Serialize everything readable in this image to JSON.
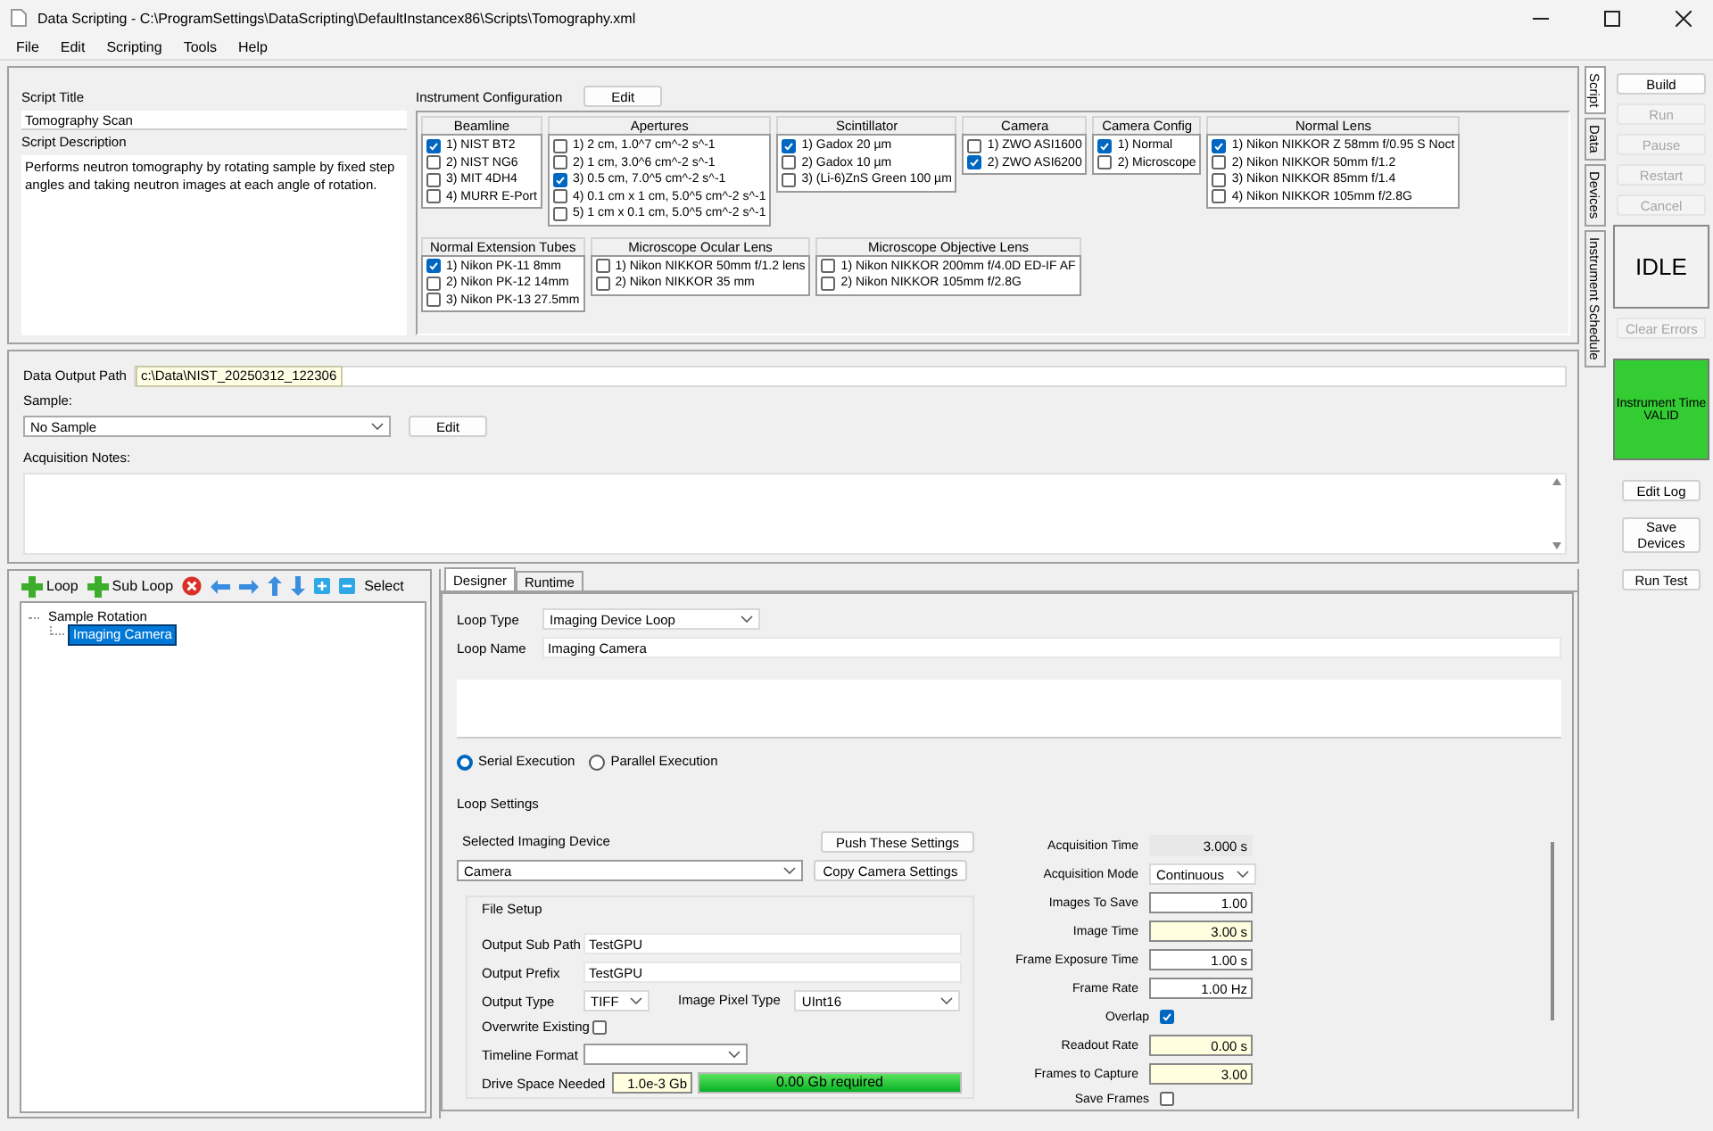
{
  "window": {
    "title": "Data Scripting - C:\\ProgramSettings\\DataScripting\\DefaultInstancex86\\Scripts\\Tomography.xml",
    "menu": [
      "File",
      "Edit",
      "Scripting",
      "Tools",
      "Help"
    ]
  },
  "script": {
    "title_label": "Script Title",
    "title": "Tomography Scan",
    "description_label": "Script Description",
    "description": "Performs neutron tomography by rotating sample by fixed step angles and taking neutron images at each angle of rotation."
  },
  "instrument_config": {
    "label": "Instrument Configuration",
    "edit_button": "Edit",
    "rows": [
      [
        {
          "title": "Beamline",
          "options": [
            {
              "label": "1) NIST BT2",
              "checked": true
            },
            {
              "label": "2) NIST NG6",
              "checked": false
            },
            {
              "label": "3) MIT 4DH4",
              "checked": false
            },
            {
              "label": "4) MURR E-Port",
              "checked": false
            }
          ]
        },
        {
          "title": "Apertures",
          "options": [
            {
              "label": "1) 2 cm, 1.0^7 cm^-2 s^-1",
              "checked": false
            },
            {
              "label": "2) 1 cm, 3.0^6 cm^-2 s^-1",
              "checked": false
            },
            {
              "label": "3) 0.5 cm, 7.0^5 cm^-2 s^-1",
              "checked": true
            },
            {
              "label": "4) 0.1 cm x 1 cm, 5.0^5 cm^-2 s^-1",
              "checked": false
            },
            {
              "label": "5) 1 cm x 0.1 cm, 5.0^5 cm^-2 s^-1",
              "checked": false
            }
          ]
        },
        {
          "title": "Scintillator",
          "options": [
            {
              "label": "1) Gadox 20 µm",
              "checked": true
            },
            {
              "label": "2) Gadox 10 µm",
              "checked": false
            },
            {
              "label": "3) (Li-6)ZnS Green 100 µm",
              "checked": false
            }
          ]
        },
        {
          "title": "Camera",
          "options": [
            {
              "label": "1) ZWO ASI1600",
              "checked": false
            },
            {
              "label": "2) ZWO ASI6200",
              "checked": true
            }
          ]
        },
        {
          "title": "Camera Config",
          "options": [
            {
              "label": "1) Normal",
              "checked": true
            },
            {
              "label": "2) Microscope",
              "checked": false
            }
          ]
        },
        {
          "title": "Normal Lens",
          "options": [
            {
              "label": "1) Nikon NIKKOR Z 58mm f/0.95 S Noct",
              "checked": true
            },
            {
              "label": "2) Nikon NIKKOR 50mm f/1.2",
              "checked": false
            },
            {
              "label": "3) Nikon NIKKOR 85mm f/1.4",
              "checked": false
            },
            {
              "label": "4) Nikon NIKKOR 105mm f/2.8G",
              "checked": false
            }
          ]
        }
      ],
      [
        {
          "title": "Normal Extension Tubes",
          "options": [
            {
              "label": "1) Nikon PK-11 8mm",
              "checked": true
            },
            {
              "label": "2) Nikon PK-12 14mm",
              "checked": false
            },
            {
              "label": "3) Nikon PK-13 27.5mm",
              "checked": false
            }
          ]
        },
        {
          "title": "Microscope Ocular Lens",
          "options": [
            {
              "label": "1) Nikon NIKKOR 50mm f/1.2 lens",
              "checked": false
            },
            {
              "label": "2) Nikon NIKKOR 35 mm",
              "checked": false
            }
          ]
        },
        {
          "title": "Microscope Objective Lens",
          "options": [
            {
              "label": "1) Nikon NIKKOR 200mm f/4.0D ED-IF AF",
              "checked": false
            },
            {
              "label": "2) Nikon NIKKOR 105mm f/2.8G",
              "checked": false
            }
          ]
        }
      ]
    ]
  },
  "data": {
    "output_path_label": "Data Output Path",
    "output_path": "c:\\Data\\NIST_20250312_122306",
    "sample_label": "Sample:",
    "sample": "No Sample",
    "sample_edit_button": "Edit",
    "notes_label": "Acquisition Notes:"
  },
  "loop_toolbar": [
    {
      "kind": "add",
      "label": "Loop"
    },
    {
      "kind": "add",
      "label": "Sub Loop"
    },
    {
      "kind": "delete"
    },
    {
      "kind": "left"
    },
    {
      "kind": "right"
    },
    {
      "kind": "up"
    },
    {
      "kind": "down"
    },
    {
      "kind": "expand"
    },
    {
      "kind": "collapse"
    },
    {
      "kind": "text",
      "label": "Select"
    }
  ],
  "tree": [
    {
      "label": "Sample Rotation",
      "selected": false,
      "children": [
        {
          "label": "Imaging Camera",
          "selected": true
        }
      ]
    }
  ],
  "designer": {
    "tabs": [
      {
        "label": "Designer",
        "selected": true
      },
      {
        "label": "Runtime",
        "selected": false
      }
    ],
    "loop_type_label": "Loop Type",
    "loop_type": "Imaging Device Loop",
    "loop_name_label": "Loop Name",
    "loop_name": "Imaging Camera",
    "execution": [
      {
        "label": "Serial Execution",
        "selected": true
      },
      {
        "label": "Parallel Execution",
        "selected": false
      }
    ],
    "loop_settings_label": "Loop Settings",
    "device_label": "Selected Imaging Device",
    "device": "Camera",
    "buttons": [
      "Push These Settings",
      "Copy Camera Settings"
    ],
    "file_setup": {
      "title": "File Setup",
      "sub_path_label": "Output Sub Path",
      "sub_path": "TestGPU",
      "prefix_label": "Output Prefix",
      "prefix": "TestGPU",
      "type_label": "Output Type",
      "type": "TIFF",
      "pixel_label": "Image Pixel Type",
      "pixel": "UInt16",
      "overwrite": {
        "label": "Overwrite Existing",
        "checked": false
      },
      "timeline_label": "Timeline Format",
      "drive_label": "Drive Space Needed",
      "drive_value": "1.0e-3 Gb",
      "required": "0.00 Gb required",
      "level": 1
    },
    "acquisition": [
      {
        "kind": "readonly",
        "label": "Acquisition Time",
        "value": "3.000 s"
      },
      {
        "kind": "select",
        "label": "Acquisition Mode",
        "value": "Continuous"
      },
      {
        "kind": "input",
        "label": "Images To Save",
        "value": "1.00",
        "highlighted": false
      },
      {
        "kind": "input",
        "label": "Image Time",
        "value": "3.00 s",
        "highlighted": true
      },
      {
        "kind": "input",
        "label": "Frame Exposure Time",
        "value": "1.00 s",
        "highlighted": false
      },
      {
        "kind": "input",
        "label": "Frame Rate",
        "value": "1.00 Hz",
        "highlighted": false
      },
      {
        "kind": "checkbox",
        "label": "Overlap",
        "checked": true
      },
      {
        "kind": "input",
        "label": "Readout Rate",
        "value": "0.00 s",
        "highlighted": true
      },
      {
        "kind": "input",
        "label": "Frames to Capture",
        "value": "3.00",
        "highlighted": true
      },
      {
        "kind": "checkbox",
        "label": "Save Frames",
        "checked": false
      }
    ]
  },
  "sidebar": {
    "tabs": [
      {
        "label": "Script",
        "selected": true
      },
      {
        "label": "Data",
        "selected": false
      },
      {
        "label": "Devices",
        "selected": false
      },
      {
        "label": "Instrument Schedule",
        "selected": false
      }
    ],
    "controls": [
      {
        "label": "Build",
        "disabled": false
      },
      {
        "label": "Run",
        "disabled": true
      },
      {
        "label": "Pause",
        "disabled": true
      },
      {
        "label": "Restart",
        "disabled": true
      },
      {
        "label": "Cancel",
        "disabled": true
      }
    ],
    "status": "IDLE",
    "clear_errors": {
      "label": "Clear Errors",
      "disabled": true
    },
    "instrument_time": {
      "title": "Instrument Time",
      "status": "VALID"
    },
    "actions": [
      "Edit Log",
      "Save Devices",
      "Run Test"
    ]
  }
}
